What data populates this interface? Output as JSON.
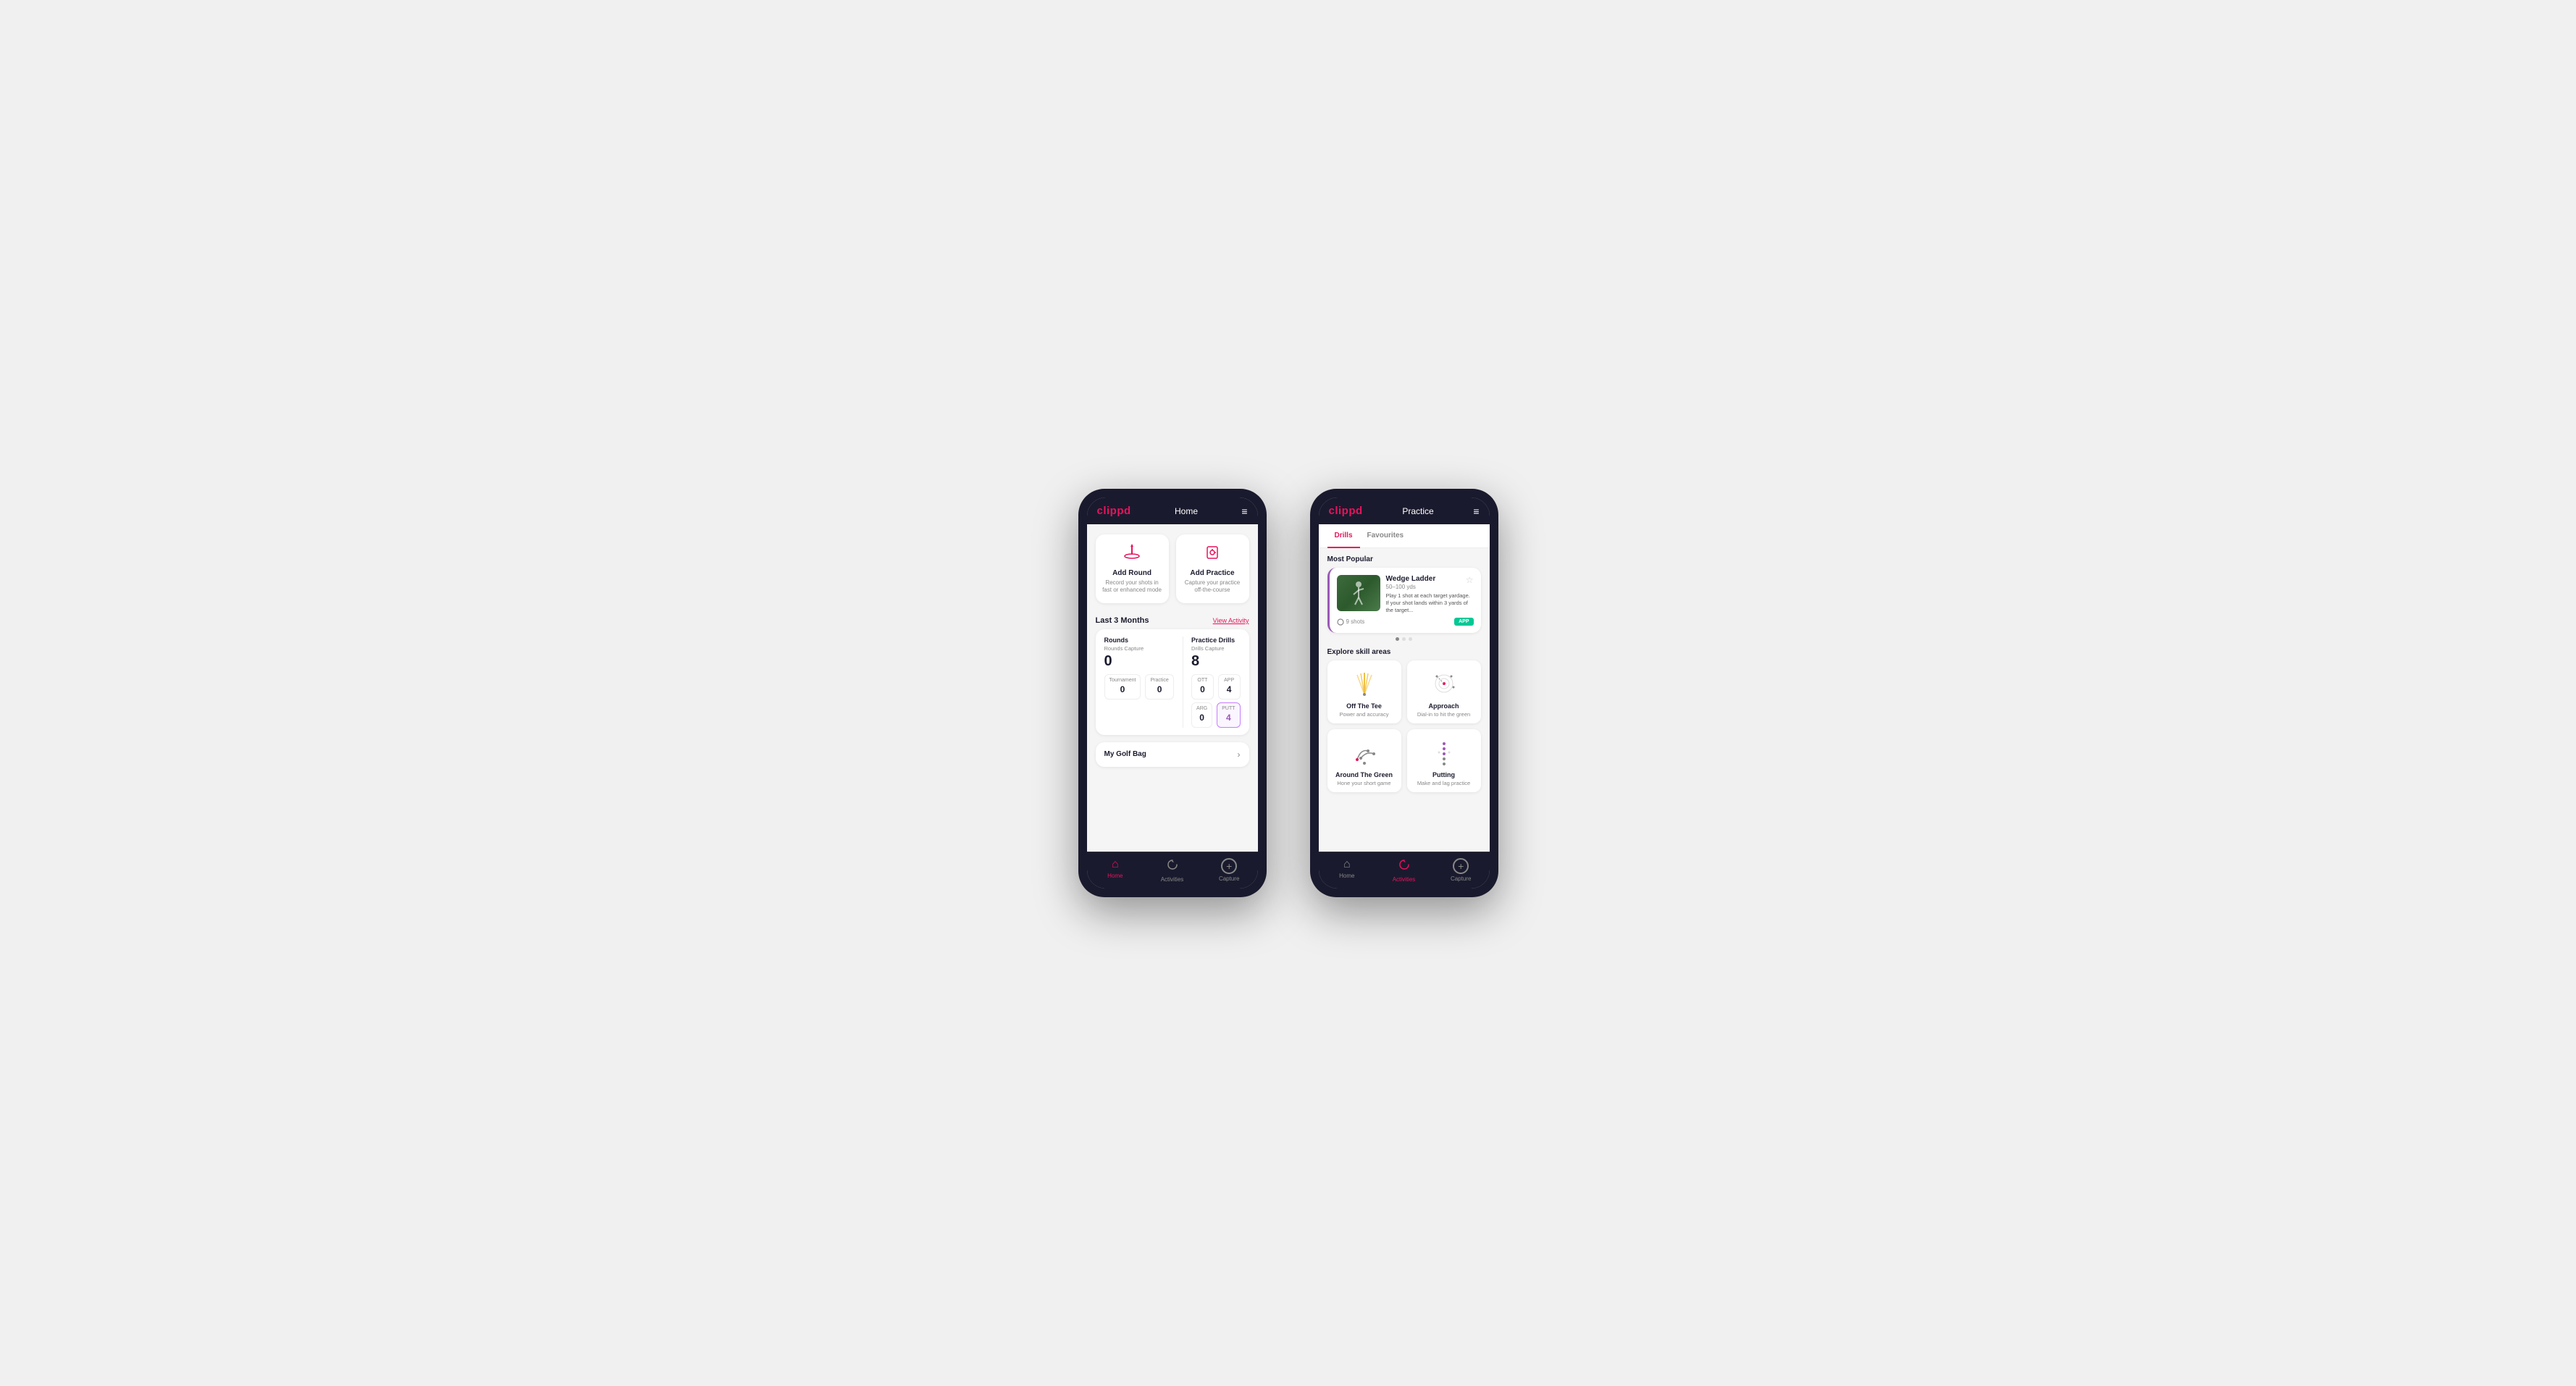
{
  "phone1": {
    "header": {
      "logo": "clippd",
      "title": "Home",
      "menu": "≡"
    },
    "actions": [
      {
        "id": "add-round",
        "icon": "⛳",
        "title": "Add Round",
        "desc": "Record your shots in fast or enhanced mode"
      },
      {
        "id": "add-practice",
        "icon": "🎯",
        "title": "Add Practice",
        "desc": "Capture your practice off-the-course"
      }
    ],
    "activity": {
      "title": "Last 3 Months",
      "link": "View Activity"
    },
    "rounds": {
      "title": "Rounds",
      "capture_label": "Rounds Capture",
      "capture_value": "0",
      "tournament_label": "Tournament",
      "tournament_value": "0",
      "practice_label": "Practice",
      "practice_value": "0"
    },
    "drills": {
      "title": "Practice Drills",
      "capture_label": "Drills Capture",
      "capture_value": "8",
      "ott_label": "OTT",
      "ott_value": "0",
      "app_label": "APP",
      "app_value": "4",
      "arg_label": "ARG",
      "arg_value": "0",
      "putt_label": "PUTT",
      "putt_value": "4"
    },
    "golf_bag": "My Golf Bag",
    "nav": [
      {
        "label": "Home",
        "icon": "🏠",
        "active": true
      },
      {
        "label": "Activities",
        "icon": "♻",
        "active": false
      },
      {
        "label": "Capture",
        "icon": "➕",
        "active": false
      }
    ]
  },
  "phone2": {
    "header": {
      "logo": "clippd",
      "title": "Practice",
      "menu": "≡"
    },
    "tabs": [
      {
        "label": "Drills",
        "active": true
      },
      {
        "label": "Favourites",
        "active": false
      }
    ],
    "most_popular": "Most Popular",
    "featured_drill": {
      "title": "Wedge Ladder",
      "yds": "50–100 yds",
      "desc": "Play 1 shot at each target yardage. If your shot lands within 3 yards of the target...",
      "shots": "9 shots",
      "badge": "APP"
    },
    "explore_label": "Explore skill areas",
    "skills": [
      {
        "id": "off-the-tee",
        "name": "Off The Tee",
        "desc": "Power and accuracy"
      },
      {
        "id": "approach",
        "name": "Approach",
        "desc": "Dial-in to hit the green"
      },
      {
        "id": "around-the-green",
        "name": "Around The Green",
        "desc": "Hone your short game"
      },
      {
        "id": "putting",
        "name": "Putting",
        "desc": "Make and lag practice"
      }
    ],
    "nav": [
      {
        "label": "Home",
        "icon": "🏠",
        "active": false
      },
      {
        "label": "Activities",
        "icon": "♻",
        "active": true
      },
      {
        "label": "Capture",
        "icon": "➕",
        "active": false
      }
    ]
  }
}
